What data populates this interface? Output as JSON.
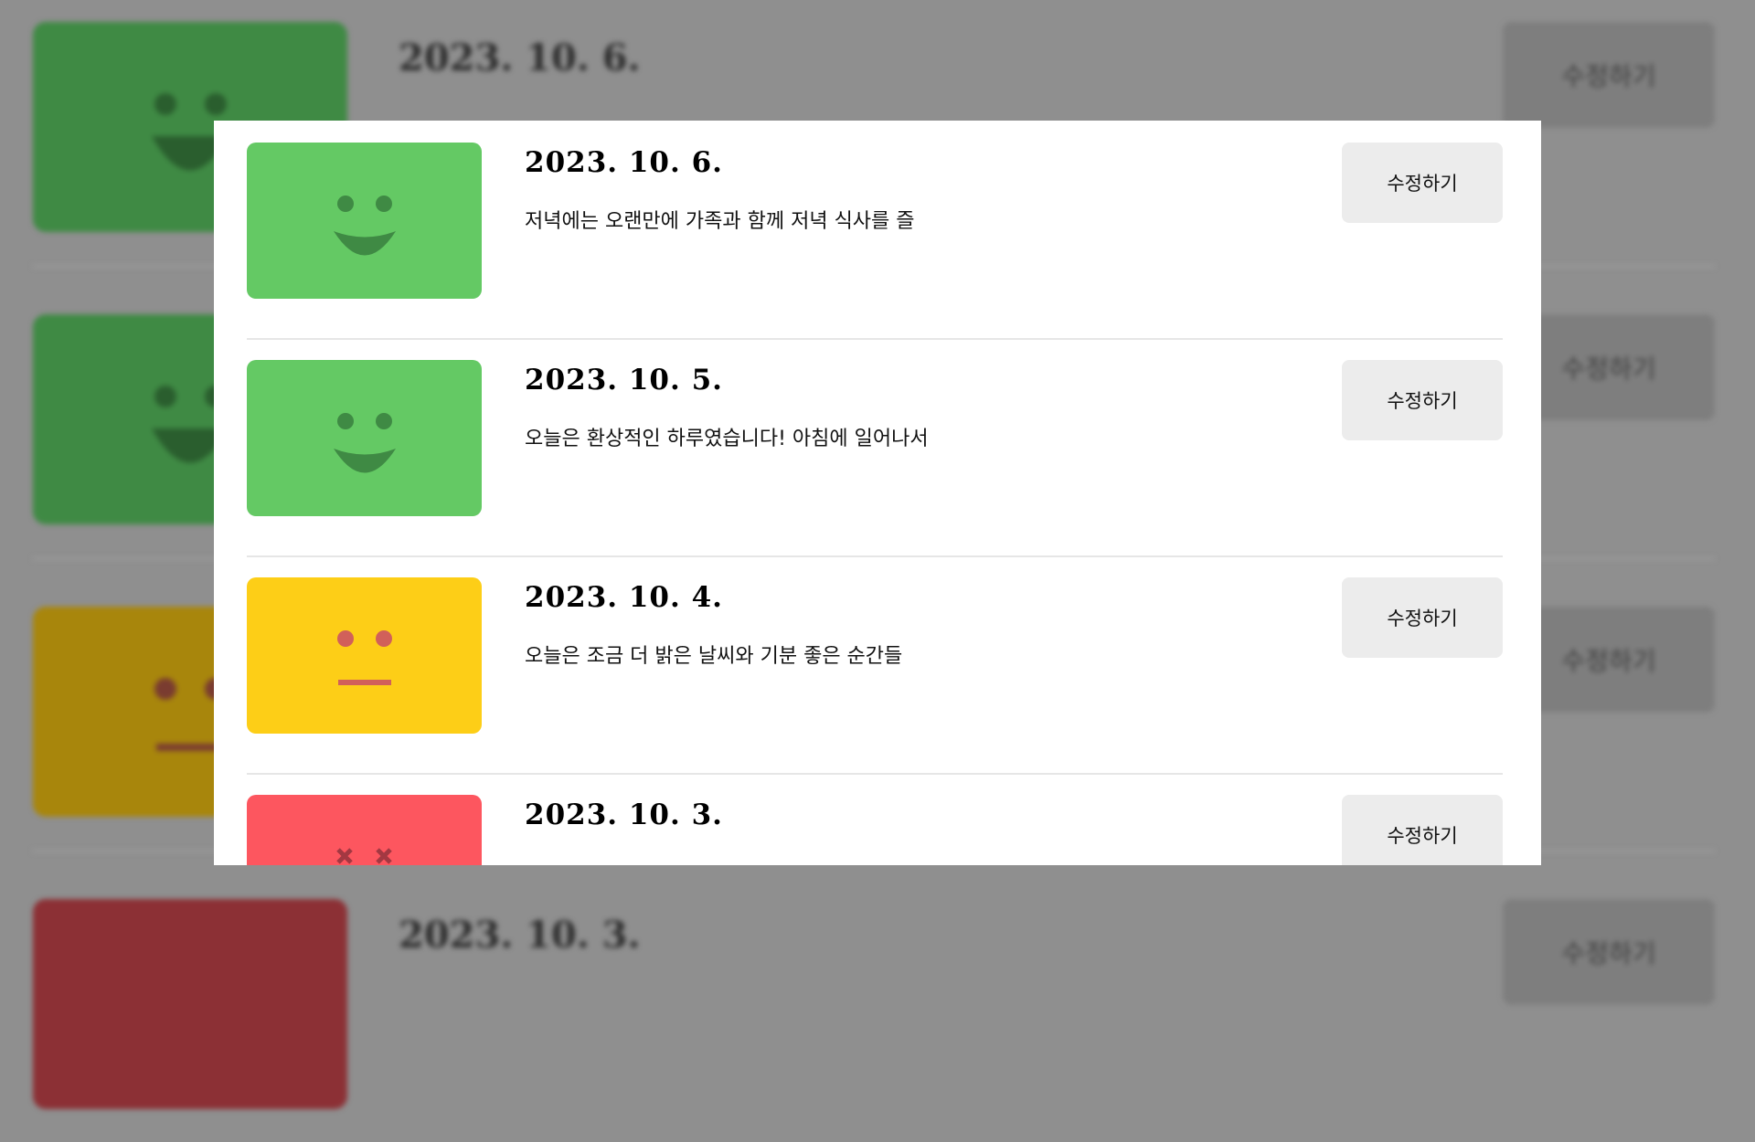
{
  "colors": {
    "excellent": "#64c964",
    "excellent_face": "#3f8a44",
    "normal": "#fdce17",
    "normal_face": "#d1605a",
    "terrible": "#fd565f",
    "terrible_face": "#a33842",
    "edit_button_bg": "#ececec",
    "overlay_bg": "#8f8f8f"
  },
  "diary": {
    "entries": [
      {
        "date": "2023. 10. 6.",
        "content": "저녁에는 오랜만에 가족과 함께 저녁 식사를 즐",
        "emotion": "smile-icon",
        "edit_label": "수정하기"
      },
      {
        "date": "2023. 10. 5.",
        "content": "오늘은 환상적인 하루였습니다! 아침에 일어나서",
        "emotion": "smile-icon",
        "edit_label": "수정하기"
      },
      {
        "date": "2023. 10. 4.",
        "content": "오늘은 조금 더 밝은 날씨와 기분 좋은 순간들",
        "emotion": "neutral-face-icon",
        "edit_label": "수정하기"
      },
      {
        "date": "2023. 10. 3.",
        "content": "",
        "emotion": "sad-face-icon",
        "edit_label": "수정하기"
      }
    ]
  },
  "background": {
    "entries": [
      {
        "date": "2023. 10. 6.",
        "edit_label": "수정하기"
      },
      {
        "date": "2023. 10. 3.",
        "edit_label": "수정하기"
      }
    ]
  }
}
